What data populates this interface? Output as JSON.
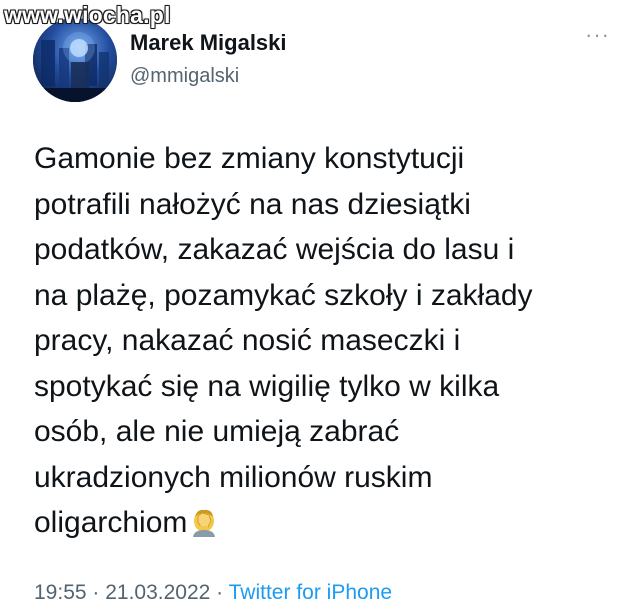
{
  "watermark": "www.wiocha.pl",
  "author": {
    "display_name": "Marek Migalski",
    "handle": "@mmigalski",
    "avatar": "profile-avatar"
  },
  "more_menu": {
    "icon": "more-icon",
    "glyph": "···"
  },
  "tweet": {
    "lines": [
      "Gamonie bez zmiany konstytucji",
      "potrafili nałożyć na nas dziesiątki",
      "podatków, zakazać wejścia do lasu i",
      "na plażę, pozamykać szkoły i zakłady",
      "pracy, nakazać nosić maseczki i",
      "spotykać się na wigilię tylko w kilka",
      "osób, ale nie umieją zabrać",
      "ukradzionych milionów ruskim",
      "oligarchiom"
    ],
    "emoji": "facepalm-emoji"
  },
  "meta": {
    "time": "19:55",
    "separator": " · ",
    "date": "21.03.2022",
    "separator2": " · ",
    "source": "Twitter for iPhone"
  },
  "colors": {
    "text": "#0f1419",
    "secondary": "#536471",
    "link": "#1d9bf0"
  }
}
